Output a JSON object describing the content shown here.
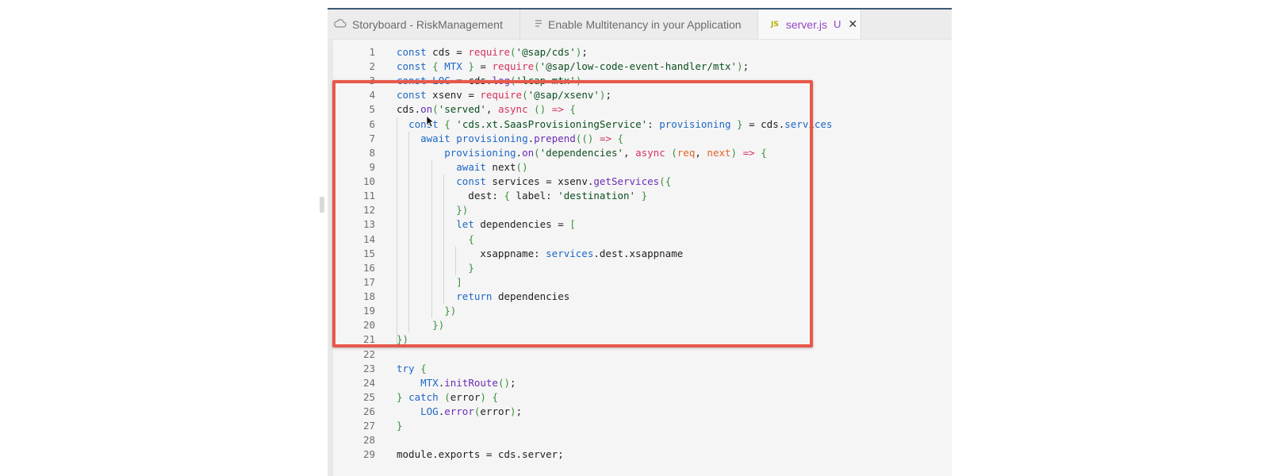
{
  "tabs": [
    {
      "label": "Storyboard - RiskManagement",
      "icon": "cloud-icon"
    },
    {
      "label": "Enable Multitenancy in your Application",
      "icon": "document-icon"
    },
    {
      "label": "server.js",
      "icon": "js-badge",
      "badge": "JS",
      "status": "U",
      "close": "✕"
    }
  ],
  "code": {
    "line_numbers": [
      "1",
      "2",
      "3",
      "4",
      "5",
      "6",
      "7",
      "8",
      "9",
      "10",
      "11",
      "12",
      "13",
      "14",
      "15",
      "16",
      "17",
      "18",
      "19",
      "20",
      "21",
      "22",
      "23",
      "24",
      "25",
      "26",
      "27",
      "28",
      "29"
    ],
    "lines": [
      "const cds = require('@sap/cds');",
      "const { MTX } = require('@sap/low-code-event-handler/mtx');",
      "const LOG = cds.log('lcap-mtx')",
      "const xsenv = require('@sap/xsenv');",
      "cds.on('served', async () => {",
      "  const { 'cds.xt.SaasProvisioningService': provisioning } = cds.services",
      "    await provisioning.prepend(() => {",
      "        provisioning.on('dependencies', async (req, next) => {",
      "          await next()",
      "          const services = xsenv.getServices({",
      "            dest: { label: 'destination' }",
      "          })",
      "          let dependencies = [",
      "            {",
      "              xsappname: services.dest.xsappname",
      "            }",
      "          ]",
      "          return dependencies",
      "        })",
      "      })",
      "})",
      "",
      "try {",
      "    MTX.initRoute();",
      "} catch (error) {",
      "    LOG.error(error);",
      "}",
      "",
      "module.exports = cds.server;"
    ]
  },
  "colors": {
    "highlight_border": "#e8584b",
    "active_tab_text": "#9147c6",
    "keyword": "#1d67c5",
    "string": "#0b4f1f"
  }
}
